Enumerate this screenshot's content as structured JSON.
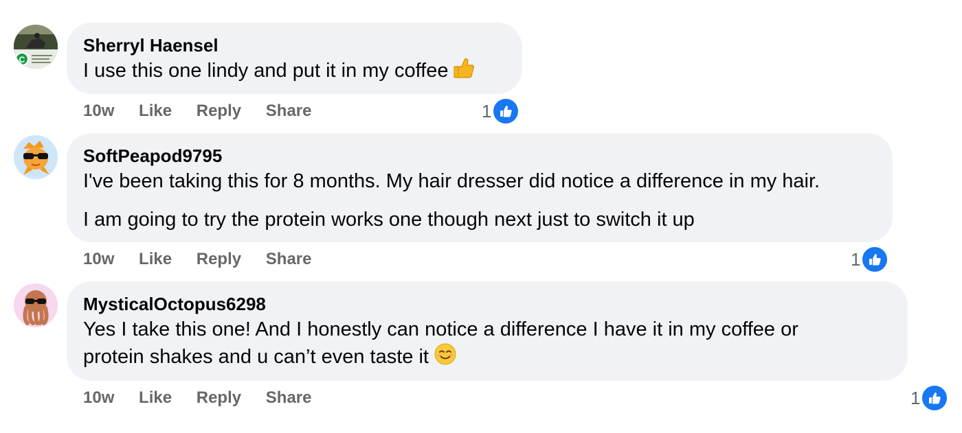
{
  "comments": [
    {
      "author": "Sherryl Haensel",
      "text_lines": [
        "I use this one lindy and put it in my coffee"
      ],
      "emoji": "thumbs-up",
      "time": "10w",
      "like_label": "Like",
      "reply_label": "Reply",
      "share_label": "Share",
      "reaction_count": "1",
      "avatar": "horse-rider-photo"
    },
    {
      "author": "SoftPeapod9795",
      "text_lines": [
        "I've been taking this for 8 months. My hair dresser did notice a difference in my hair.",
        "I am going to try the protein works one though next just to switch it up"
      ],
      "time": "10w",
      "like_label": "Like",
      "reply_label": "Reply",
      "share_label": "Share",
      "reaction_count": "1",
      "avatar": "goldfish-sunglasses"
    },
    {
      "author": "MysticalOctopus6298",
      "text_lines": [
        "Yes I take this one! And I honestly can notice a difference I have it in my coffee or",
        "protein shakes and u can’t even taste it"
      ],
      "emoji": "smiling-face",
      "time": "10w",
      "like_label": "Like",
      "reply_label": "Reply",
      "share_label": "Share",
      "reaction_count": "1",
      "avatar": "octopus-sunglasses"
    }
  ],
  "colors": {
    "bubble": "#f0f2f5",
    "meta_text": "#65676b",
    "like_blue": "#1877f2"
  }
}
